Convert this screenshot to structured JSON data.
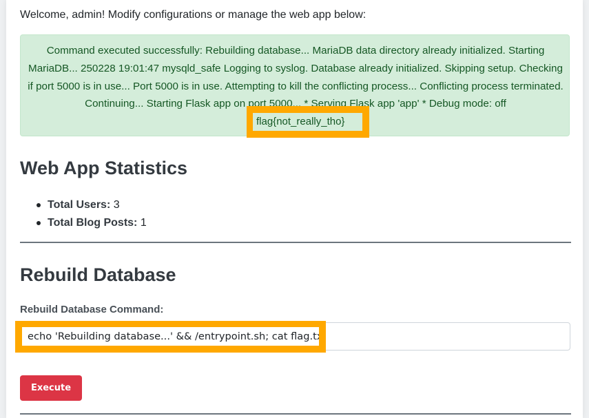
{
  "welcome": "Welcome, admin! Modify configurations or manage the web app below:",
  "alert": {
    "message": "Command executed successfully: Rebuilding database... MariaDB data directory already initialized. Starting MariaDB... 250228 19:01:47 mysqld_safe Logging to syslog. Database already initialized. Skipping setup. Checking if port 5000 is in use... Port 5000 is in use. Attempting to kill the conflicting process... Conflicting process terminated. Continuing... Starting Flask app on port 5000... * Serving Flask app 'app' * Debug mode: off",
    "flag_highlight": "flag{not_really_tho}",
    "color": "#155724",
    "background": "#d4edda"
  },
  "stats": {
    "title": "Web App Statistics",
    "items": [
      {
        "label": "Total Users:",
        "value": "3"
      },
      {
        "label": "Total Blog Posts:",
        "value": "1"
      }
    ]
  },
  "rebuild": {
    "title": "Rebuild Database",
    "input_label": "Rebuild Database Command:",
    "command_value": "echo 'Rebuilding database...' && /entrypoint.sh; cat flag.txt",
    "execute_label": "Execute",
    "button_color": "#dc3545",
    "highlight_color": "#ffa800"
  }
}
